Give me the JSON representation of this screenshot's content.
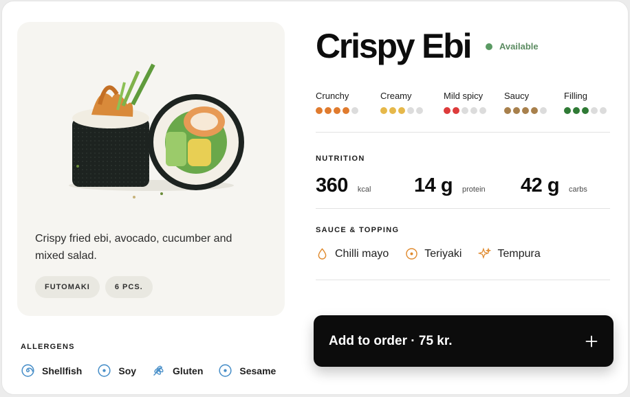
{
  "product": {
    "title": "Crispy Ebi",
    "availability": "Available",
    "description": "Crispy fried ebi, avocado, cucumber and mixed salad.",
    "tags": [
      "FUTOMAKI",
      "6 PCS."
    ],
    "image_icon": "sushi-roll-photo"
  },
  "flavors": [
    {
      "label": "Crunchy",
      "level": 4,
      "max": 5,
      "color": "#e07b2e"
    },
    {
      "label": "Creamy",
      "level": 3,
      "max": 5,
      "color": "#e6b84a"
    },
    {
      "label": "Mild spicy",
      "level": 2,
      "max": 5,
      "color": "#dd3b3b"
    },
    {
      "label": "Saucy",
      "level": 4,
      "max": 5,
      "color": "#a8804c"
    },
    {
      "label": "Filling",
      "level": 3,
      "max": 5,
      "color": "#2f7a35"
    }
  ],
  "nutrition": {
    "title": "NUTRITION",
    "items": [
      {
        "value": "360",
        "unit": "kcal"
      },
      {
        "value": "14 g",
        "unit": "protein"
      },
      {
        "value": "42 g",
        "unit": "carbs"
      }
    ]
  },
  "sauce_topping": {
    "title": "SAUCE & TOPPING",
    "items": [
      {
        "label": "Chilli mayo",
        "icon": "droplet-icon"
      },
      {
        "label": "Teriyaki",
        "icon": "dot-circle-icon"
      },
      {
        "label": "Tempura",
        "icon": "sparkle-icon"
      }
    ],
    "icon_color": "#e08a2e"
  },
  "allergens": {
    "title": "ALLERGENS",
    "items": [
      {
        "label": "Shellfish",
        "icon": "spiral-icon"
      },
      {
        "label": "Soy",
        "icon": "dot-circle-icon"
      },
      {
        "label": "Gluten",
        "icon": "wheat-icon"
      },
      {
        "label": "Sesame",
        "icon": "dot-circle-icon"
      }
    ],
    "icon_color": "#4a90c9"
  },
  "order": {
    "label": "Add to order · 75 kr.",
    "icon": "plus-icon"
  },
  "colors": {
    "available": "#5a9a63",
    "button_bg": "#0c0c0c"
  }
}
